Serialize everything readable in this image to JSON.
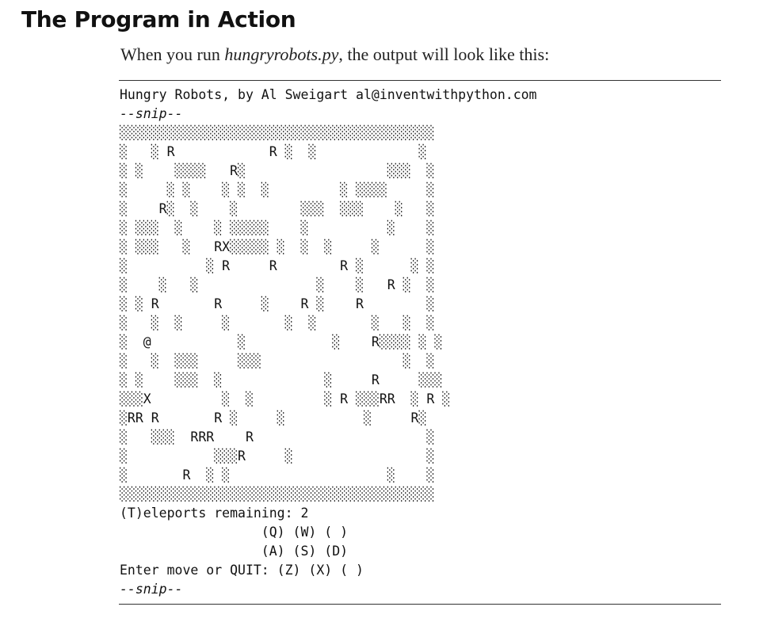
{
  "heading": "The Program in Action",
  "intro": {
    "prefix": "When you run ",
    "filename": "hungryrobots.py",
    "suffix": ", the output will look like this:"
  },
  "console": {
    "title_line": "Hungry Robots, by Al Sweigart al@inventwithpython.com",
    "snip_top": "--snip--",
    "board_rows": [
      "░░░░░░░░░░░░░░░░░░░░░░░░░░░░░░░░░░░░░░░░",
      "░   ░ R            R ░  ░             ░",
      "░ ░    ░░░░   R░                  ░░░  ░",
      "░     ░ ░    ░ ░  ░         ░ ░░░░     ░",
      "░    R░  ░    ░        ░░░  ░░░    ░   ░",
      "░ ░░░  ░    ░ ░░░░░    ░          ░    ░",
      "░ ░░░   ░   RX░░░░░ ░  ░  ░     ░      ░",
      "░          ░ R     R        R ░      ░ ░",
      "░    ░   ░               ░    ░   R ░  ░",
      "░ ░ R       R     ░    R ░    R        ░",
      "░   ░  ░     ░       ░  ░       ░   ░  ░",
      "░  @           ░           ░    R░░░░ ░ ░",
      "░   ░  ░░░     ░░░                  ░  ░",
      "░ ░    ░░░  ░             ░     R     ░░░",
      "░░░X         ░  ░         ░ R ░░░RR  ░ R ░",
      "░RR R       R ░     ░          ░     R░",
      "░   ░░░  RRR    R                      ░",
      "░           ░░░R     ░                 ░",
      "░       R  ░ ░                    ░    ░",
      "░░░░░░░░░░░░░░░░░░░░░░░░░░░░░░░░░░░░░░░░"
    ],
    "teleports_line": "(T)eleports remaining: 2",
    "controls": [
      "                  (Q) (W) ( )",
      "                  (A) (S) (D)",
      "Enter move or QUIT: (Z) (X) ( )"
    ],
    "snip_bottom": "--snip--"
  }
}
